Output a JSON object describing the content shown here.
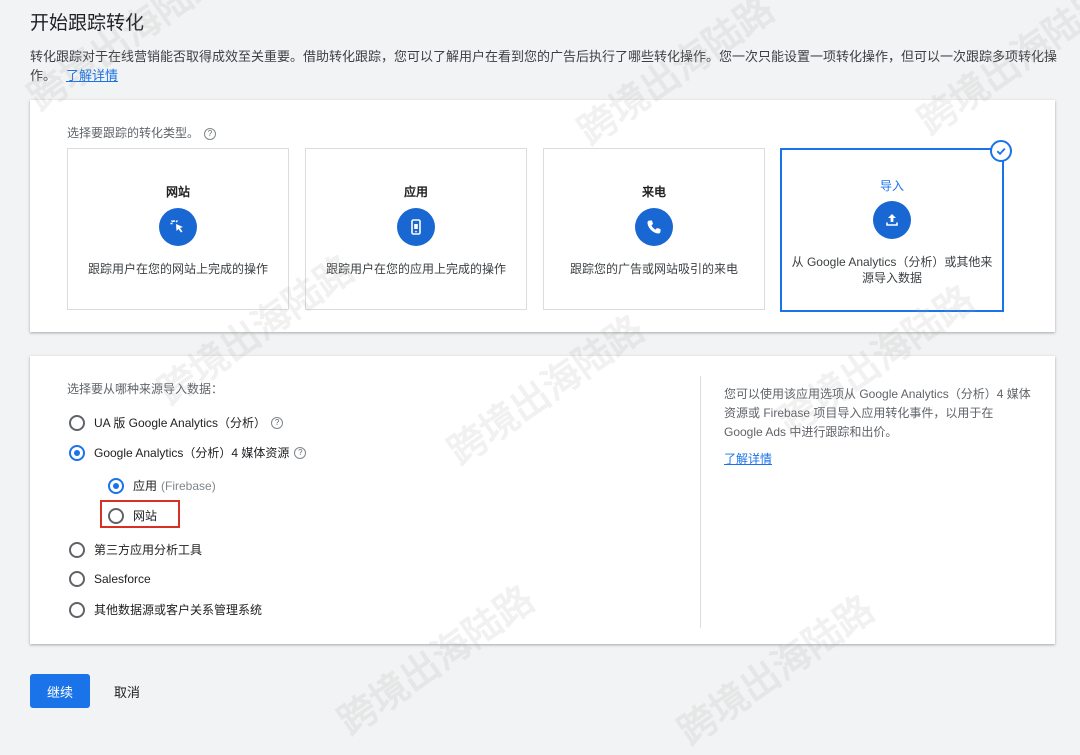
{
  "page": {
    "title": "开始跟踪转化",
    "intro": "转化跟踪对于在线营销能否取得成效至关重要。借助转化跟踪，您可以了解用户在看到您的广告后执行了哪些转化操作。您一次只能设置一项转化操作，但可以一次跟踪多项转化操作。",
    "intro_link": "了解详情"
  },
  "type_section": {
    "label": "选择要跟踪的转化类型。",
    "tiles": [
      {
        "title": "网站",
        "desc": "跟踪用户在您的网站上完成的操作",
        "icon": "cursor-click-icon",
        "selected": false
      },
      {
        "title": "应用",
        "desc": "跟踪用户在您的应用上完成的操作",
        "icon": "mobile-phone-icon",
        "selected": false
      },
      {
        "title": "来电",
        "desc": "跟踪您的广告或网站吸引的来电",
        "icon": "phone-icon",
        "selected": false
      },
      {
        "title": "导入",
        "desc": "从 Google Analytics（分析）或其他来源导入数据",
        "icon": "upload-icon",
        "selected": true
      }
    ]
  },
  "source_section": {
    "label": "选择要从哪种来源导入数据：",
    "options": [
      {
        "label": "UA 版 Google Analytics（分析）",
        "selected": false
      },
      {
        "label": "Google Analytics（分析）4 媒体资源",
        "selected": true
      },
      {
        "label": "第三方应用分析工具",
        "selected": false
      },
      {
        "label": "Salesforce",
        "selected": false
      },
      {
        "label": "其他数据源或客户关系管理系统",
        "selected": false
      }
    ],
    "sub_options": [
      {
        "label": "应用",
        "suffix": "(Firebase)",
        "selected": true
      },
      {
        "label": "网站",
        "selected": false
      }
    ],
    "side_text": "您可以使用该应用选项从 Google Analytics（分析）4 媒体资源或 Firebase 项目导入应用转化事件，以用于在 Google Ads 中进行跟踪和出价。",
    "side_link": "了解详情"
  },
  "actions": {
    "continue": "继续",
    "cancel": "取消"
  },
  "watermark": "跨境出海陆路",
  "colors": {
    "accent": "#1a73e8",
    "icon_bg": "#1967d2",
    "highlight": "#d93025"
  }
}
